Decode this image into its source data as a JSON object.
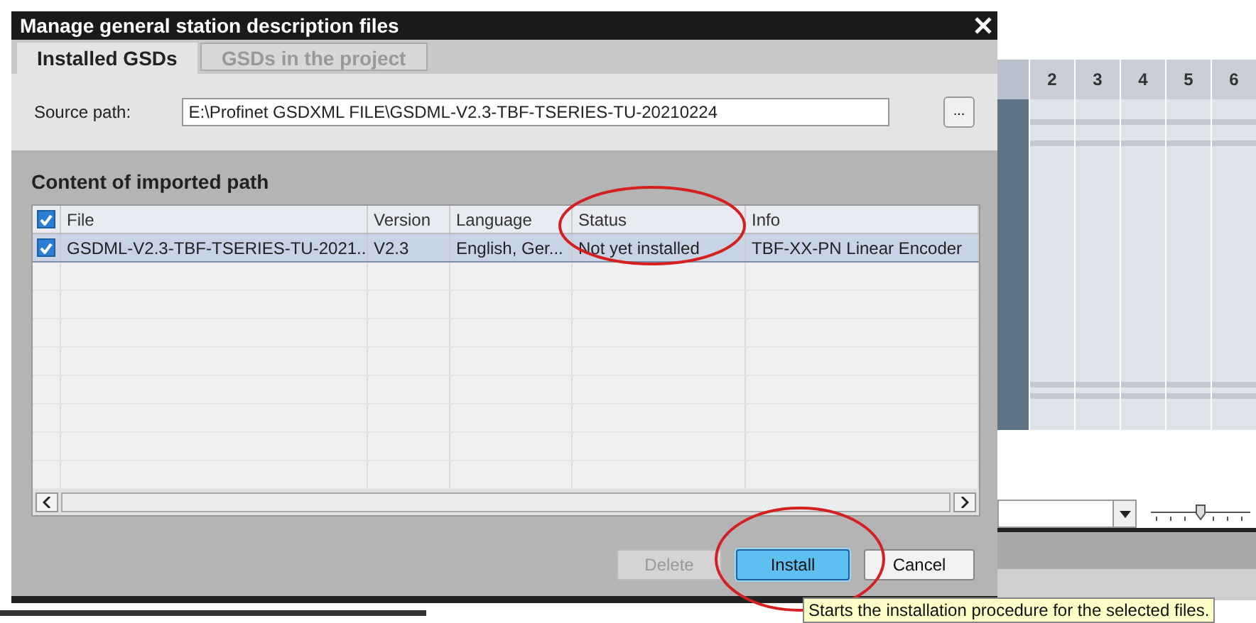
{
  "background": {
    "column_headers": [
      "2",
      "3",
      "4",
      "5",
      "6"
    ],
    "zoom_slider": {
      "level": 0.5
    }
  },
  "window": {
    "title": "Manage general station description files"
  },
  "tabs": [
    {
      "label": "Installed GSDs",
      "selected": true
    },
    {
      "label": "GSDs in the project",
      "selected": false
    }
  ],
  "source_path": {
    "label": "Source path:",
    "value": "E:\\Profinet GSDXML FILE\\GSDML-V2.3-TBF-TSERIES-TU-20210224",
    "browse": "..."
  },
  "section_title": "Content of imported path",
  "table": {
    "all_checked": true,
    "columns": [
      "File",
      "Version",
      "Language",
      "Status",
      "Info"
    ],
    "rows": [
      {
        "checked": true,
        "selected": true,
        "cells": [
          "GSDML-V2.3-TBF-TSERIES-TU-2021...",
          "V2.3",
          "English, Ger...",
          "Not yet installed",
          "TBF-XX-PN Linear Encoder"
        ]
      }
    ]
  },
  "buttons": [
    {
      "label": "Delete",
      "disabled": true,
      "default": false
    },
    {
      "label": "Install",
      "disabled": false,
      "default": true
    },
    {
      "label": "Cancel",
      "disabled": false,
      "default": false
    }
  ],
  "tooltip": "Starts the installation procedure for the selected files."
}
